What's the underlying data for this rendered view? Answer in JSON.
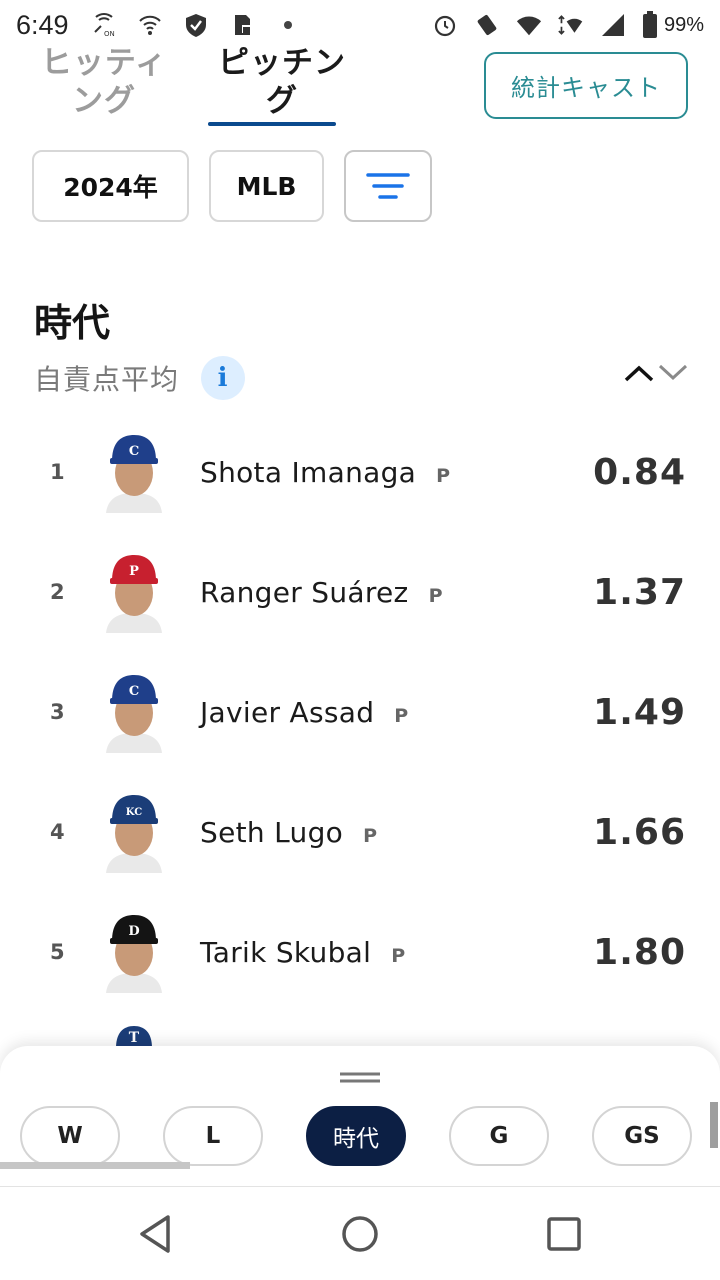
{
  "status_bar": {
    "time": "6:49",
    "battery": "99%",
    "icons": [
      "nfc-icon",
      "wifi-off-icon",
      "shield-check-icon",
      "sd-lock-icon",
      "dot-icon",
      "alarm-icon",
      "vibrate-icon",
      "wifi-icon",
      "data-arrows-icon",
      "signal-4g-icon",
      "signal-x-icon",
      "battery-icon"
    ]
  },
  "tabs": [
    {
      "label": "ヒッティング",
      "active": false
    },
    {
      "label": "ピッチング",
      "active": true
    }
  ],
  "stat_cast_button": "統計キャスト",
  "filters": {
    "year": "2024年",
    "league": "MLB",
    "sort_icon": "filter-lines-icon"
  },
  "section": {
    "title": "時代",
    "subtitle": "自責点平均",
    "info_icon": "i"
  },
  "players": [
    {
      "rank": "1",
      "name": "Shota Imanaga",
      "pos": "P",
      "value": "0.84",
      "team": "cubs",
      "cap": "#1f3f8a",
      "logo": "C"
    },
    {
      "rank": "2",
      "name": "Ranger Suárez",
      "pos": "P",
      "value": "1.37",
      "team": "phillies",
      "cap": "#c7202f",
      "logo": "P"
    },
    {
      "rank": "3",
      "name": "Javier Assad",
      "pos": "P",
      "value": "1.49",
      "team": "cubs",
      "cap": "#1f3f8a",
      "logo": "C"
    },
    {
      "rank": "4",
      "name": "Seth Lugo",
      "pos": "P",
      "value": "1.66",
      "team": "royals",
      "cap": "#1b3d78",
      "logo": "KC"
    },
    {
      "rank": "5",
      "name": "Tarik Skubal",
      "pos": "P",
      "value": "1.80",
      "team": "tigers",
      "cap": "#141414",
      "logo": "D"
    }
  ],
  "chips": [
    {
      "label": "W",
      "active": false
    },
    {
      "label": "L",
      "active": false
    },
    {
      "label": "時代",
      "active": true
    },
    {
      "label": "G",
      "active": false
    },
    {
      "label": "GS",
      "active": false
    }
  ],
  "nav": [
    "back-icon",
    "home-icon",
    "recents-icon"
  ]
}
